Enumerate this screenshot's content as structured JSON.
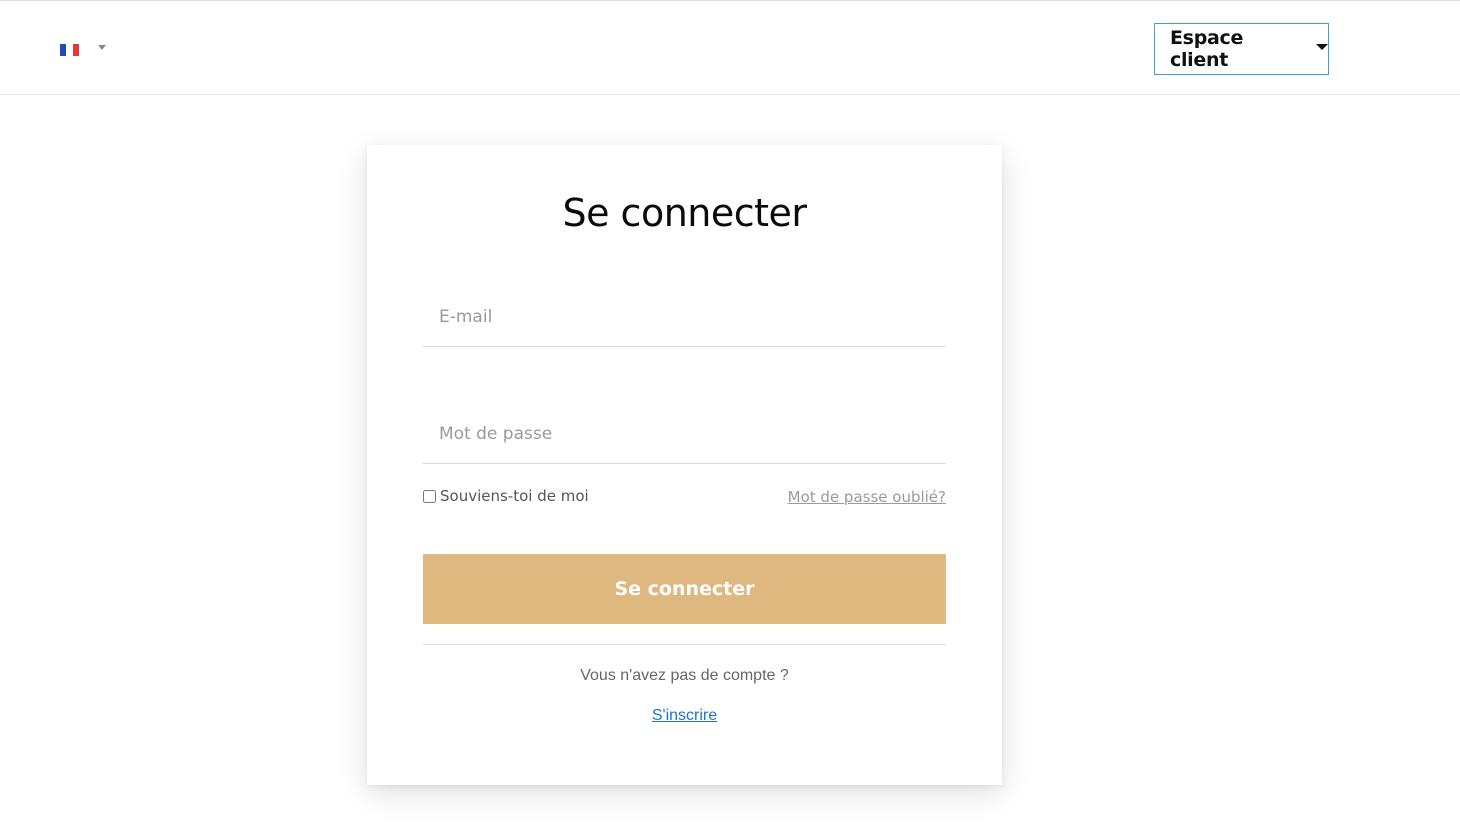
{
  "header": {
    "language": {
      "flag_icon": "flag-france-icon",
      "flag_colors": [
        "#1f4bb3",
        "#ffffff",
        "#e5363d"
      ],
      "caret_icon": "caret-down-icon"
    },
    "client_menu": {
      "label": "Espace client",
      "caret_icon": "caret-down-icon",
      "border_color": "#3fa0d6"
    }
  },
  "login": {
    "title": "Se connecter",
    "email": {
      "value": "",
      "placeholder": "E-mail"
    },
    "password": {
      "value": "",
      "placeholder": "Mot de passe"
    },
    "remember_me": {
      "label": "Souviens-toi de moi",
      "checked": false
    },
    "forgot_password": "Mot de passe oublié?",
    "submit_label": "Se connecter",
    "submit_color": "#deb87e",
    "no_account_text": "Vous n'avez pas de compte ?",
    "signup_label": "S'inscrire"
  }
}
